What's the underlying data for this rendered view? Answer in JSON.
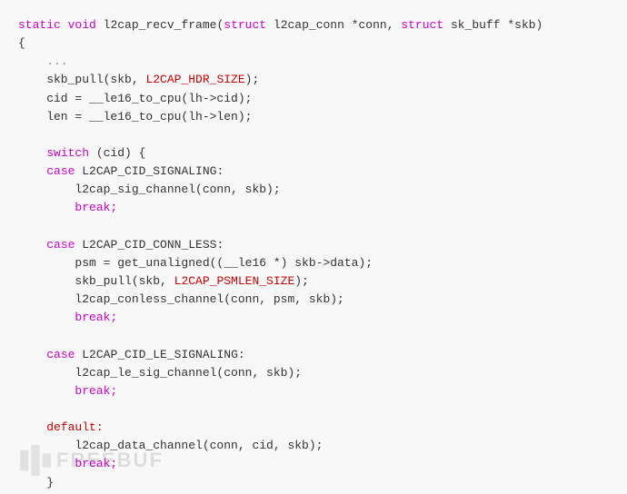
{
  "code": {
    "lines": [
      {
        "id": "l1",
        "parts": [
          {
            "text": "static",
            "cls": "kw"
          },
          {
            "text": " ",
            "cls": "plain"
          },
          {
            "text": "void",
            "cls": "kw"
          },
          {
            "text": " l2cap_recv_frame(",
            "cls": "plain"
          },
          {
            "text": "struct",
            "cls": "kw"
          },
          {
            "text": " l2cap_conn *conn, ",
            "cls": "plain"
          },
          {
            "text": "struct",
            "cls": "kw"
          },
          {
            "text": " sk_buff *skb)",
            "cls": "plain"
          }
        ]
      },
      {
        "id": "l2",
        "parts": [
          {
            "text": "{",
            "cls": "plain"
          }
        ]
      },
      {
        "id": "l3",
        "parts": [
          {
            "text": "    ...",
            "cls": "comment"
          }
        ]
      },
      {
        "id": "l4",
        "parts": [
          {
            "text": "    skb_pull(skb, L2CAP_HDR_SIZE);",
            "cls": "plain"
          }
        ]
      },
      {
        "id": "l5",
        "parts": [
          {
            "text": "    cid = __le16_to_cpu(lh->cid);",
            "cls": "plain"
          }
        ]
      },
      {
        "id": "l6",
        "parts": [
          {
            "text": "    len = __le16_to_cpu(lh->len);",
            "cls": "plain"
          }
        ]
      },
      {
        "id": "l7",
        "parts": [
          {
            "text": "",
            "cls": "plain"
          }
        ]
      },
      {
        "id": "l8",
        "parts": [
          {
            "text": "    ",
            "cls": "plain"
          },
          {
            "text": "switch",
            "cls": "kw"
          },
          {
            "text": " (cid) {",
            "cls": "plain"
          }
        ]
      },
      {
        "id": "l9",
        "parts": [
          {
            "text": "    ",
            "cls": "plain"
          },
          {
            "text": "case",
            "cls": "kw"
          },
          {
            "text": " L2CAP_CID_SIGNALING:",
            "cls": "plain"
          }
        ]
      },
      {
        "id": "l10",
        "parts": [
          {
            "text": "        l2cap_sig_channel(conn, skb);",
            "cls": "plain"
          }
        ]
      },
      {
        "id": "l11",
        "parts": [
          {
            "text": "        ",
            "cls": "plain"
          },
          {
            "text": "break;",
            "cls": "kw"
          }
        ]
      },
      {
        "id": "l12",
        "parts": [
          {
            "text": "",
            "cls": "plain"
          }
        ]
      },
      {
        "id": "l13",
        "parts": [
          {
            "text": "    ",
            "cls": "plain"
          },
          {
            "text": "case",
            "cls": "kw"
          },
          {
            "text": " L2CAP_CID_CONN_LESS:",
            "cls": "plain"
          }
        ]
      },
      {
        "id": "l14",
        "parts": [
          {
            "text": "        psm = get_unaligned((__le16 *) skb->data);",
            "cls": "plain"
          }
        ]
      },
      {
        "id": "l15",
        "parts": [
          {
            "text": "        skb_pull(skb, L2CAP_PSMLEN_SIZE);",
            "cls": "plain"
          }
        ]
      },
      {
        "id": "l16",
        "parts": [
          {
            "text": "        l2cap_conless_channel(conn, psm, skb);",
            "cls": "plain"
          }
        ]
      },
      {
        "id": "l17",
        "parts": [
          {
            "text": "        ",
            "cls": "plain"
          },
          {
            "text": "break;",
            "cls": "kw"
          }
        ]
      },
      {
        "id": "l18",
        "parts": [
          {
            "text": "",
            "cls": "plain"
          }
        ]
      },
      {
        "id": "l19",
        "parts": [
          {
            "text": "    ",
            "cls": "plain"
          },
          {
            "text": "case",
            "cls": "kw"
          },
          {
            "text": " L2CAP_CID_LE_SIGNALING:",
            "cls": "plain"
          }
        ]
      },
      {
        "id": "l20",
        "parts": [
          {
            "text": "        l2cap_le_sig_channel(conn, skb);",
            "cls": "plain"
          }
        ]
      },
      {
        "id": "l21",
        "parts": [
          {
            "text": "        ",
            "cls": "plain"
          },
          {
            "text": "break;",
            "cls": "kw"
          }
        ]
      },
      {
        "id": "l22",
        "parts": [
          {
            "text": "",
            "cls": "plain"
          }
        ]
      },
      {
        "id": "l23",
        "parts": [
          {
            "text": "    ",
            "cls": "plain"
          },
          {
            "text": "default:",
            "cls": "label"
          }
        ]
      },
      {
        "id": "l24",
        "parts": [
          {
            "text": "        l2cap_data_channel(conn, cid, skb);",
            "cls": "plain"
          }
        ]
      },
      {
        "id": "l25",
        "parts": [
          {
            "text": "        ",
            "cls": "plain"
          },
          {
            "text": "break;",
            "cls": "kw"
          }
        ]
      },
      {
        "id": "l26",
        "parts": [
          {
            "text": "    }",
            "cls": "plain"
          }
        ]
      }
    ],
    "colors": {
      "kw": "#cc00cc",
      "plain": "#333333",
      "comment": "#999999",
      "label": "#cc0000"
    }
  },
  "watermark": {
    "text": "FREEBUF"
  }
}
